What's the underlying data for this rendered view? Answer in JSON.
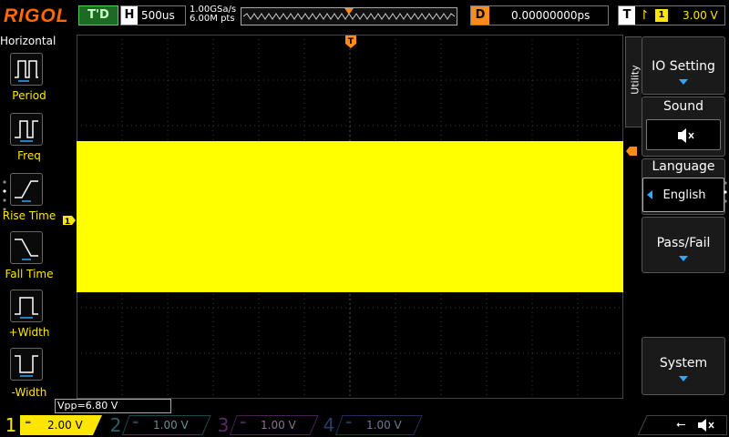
{
  "brand": "RIGOL",
  "trigger_status": "T'D",
  "timebase": {
    "key": "H",
    "value": "500us"
  },
  "sample": {
    "rate": "1.00GSa/s",
    "points": "6.00M pts"
  },
  "delay": {
    "key": "D",
    "value": "0.00000000ps"
  },
  "trigger": {
    "key": "T",
    "source": "1",
    "level": "3.00 V"
  },
  "left_menu": {
    "title": "Horizontal",
    "items": [
      {
        "label": "Period"
      },
      {
        "label": "Freq"
      },
      {
        "label": "Rise Time"
      },
      {
        "label": "Fall Time"
      },
      {
        "label": "+Width"
      },
      {
        "label": "-Width"
      }
    ]
  },
  "right_menu": {
    "tab": "Utility",
    "io_setting": "IO Setting",
    "sound": "Sound",
    "language": "Language",
    "language_value": "English",
    "pass_fail": "Pass/Fail",
    "system": "System"
  },
  "measurement": "Vpp=6.80 V",
  "channels": [
    {
      "num": "1",
      "scale": "2.00 V",
      "color": "#ffe600",
      "active": true
    },
    {
      "num": "2",
      "scale": "1.00 V",
      "color": "#19e0ff",
      "active": false
    },
    {
      "num": "3",
      "scale": "1.00 V",
      "color": "#e040ff",
      "active": false
    },
    {
      "num": "4",
      "scale": "1.00 V",
      "color": "#2e6bff",
      "active": false
    }
  ],
  "colors": {
    "accent": "#ff8c1a",
    "ch1": "#ffe600",
    "highlight": "#2ea7ff"
  }
}
